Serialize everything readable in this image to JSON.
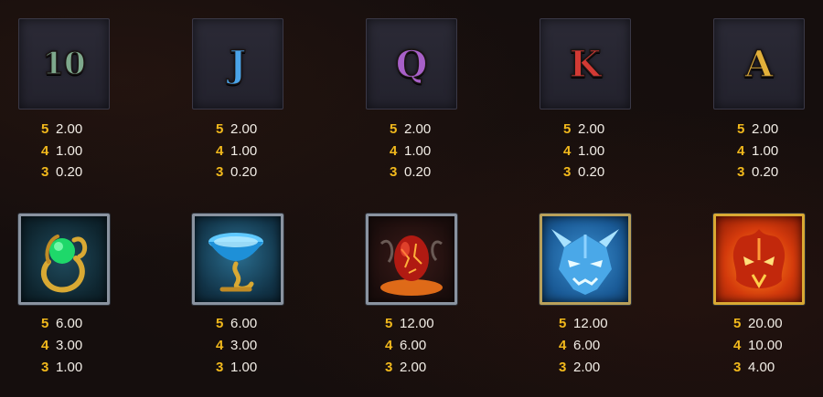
{
  "colors": {
    "background": "#150e0d",
    "count_color": "#f2b91c",
    "value_color": "#f2ede6"
  },
  "rows": [
    {
      "symbols": [
        {
          "name": "ten",
          "label": "10",
          "icon": "ten-symbol-icon",
          "color": "#7ea88c",
          "pays": [
            {
              "count": "5",
              "value": "2.00"
            },
            {
              "count": "4",
              "value": "1.00"
            },
            {
              "count": "3",
              "value": "0.20"
            }
          ]
        },
        {
          "name": "jack",
          "label": "J",
          "icon": "jack-symbol-icon",
          "color": "#4aa3e8",
          "pays": [
            {
              "count": "5",
              "value": "2.00"
            },
            {
              "count": "4",
              "value": "1.00"
            },
            {
              "count": "3",
              "value": "0.20"
            }
          ]
        },
        {
          "name": "queen",
          "label": "Q",
          "icon": "queen-symbol-icon",
          "color": "#a760c8",
          "pays": [
            {
              "count": "5",
              "value": "2.00"
            },
            {
              "count": "4",
              "value": "1.00"
            },
            {
              "count": "3",
              "value": "0.20"
            }
          ]
        },
        {
          "name": "king",
          "label": "K",
          "icon": "king-symbol-icon",
          "color": "#d23a34",
          "pays": [
            {
              "count": "5",
              "value": "2.00"
            },
            {
              "count": "4",
              "value": "1.00"
            },
            {
              "count": "3",
              "value": "0.20"
            }
          ]
        },
        {
          "name": "ace",
          "label": "A",
          "icon": "ace-symbol-icon",
          "color": "#e2b03a",
          "pays": [
            {
              "count": "5",
              "value": "2.00"
            },
            {
              "count": "4",
              "value": "1.00"
            },
            {
              "count": "3",
              "value": "0.20"
            }
          ]
        }
      ]
    },
    {
      "symbols": [
        {
          "name": "emerald-ring",
          "icon": "emerald-ring-icon",
          "pays": [
            {
              "count": "5",
              "value": "6.00"
            },
            {
              "count": "4",
              "value": "3.00"
            },
            {
              "count": "3",
              "value": "1.00"
            }
          ]
        },
        {
          "name": "blue-chalice",
          "icon": "blue-chalice-icon",
          "pays": [
            {
              "count": "5",
              "value": "6.00"
            },
            {
              "count": "4",
              "value": "3.00"
            },
            {
              "count": "3",
              "value": "1.00"
            }
          ]
        },
        {
          "name": "dragon-egg",
          "icon": "dragon-egg-icon",
          "pays": [
            {
              "count": "5",
              "value": "12.00"
            },
            {
              "count": "4",
              "value": "6.00"
            },
            {
              "count": "3",
              "value": "2.00"
            }
          ]
        },
        {
          "name": "ice-dragon",
          "icon": "ice-dragon-icon",
          "pays": [
            {
              "count": "5",
              "value": "12.00"
            },
            {
              "count": "4",
              "value": "6.00"
            },
            {
              "count": "3",
              "value": "2.00"
            }
          ]
        },
        {
          "name": "fire-dragon",
          "icon": "fire-dragon-icon",
          "pays": [
            {
              "count": "5",
              "value": "20.00"
            },
            {
              "count": "4",
              "value": "10.00"
            },
            {
              "count": "3",
              "value": "4.00"
            }
          ]
        }
      ]
    }
  ]
}
